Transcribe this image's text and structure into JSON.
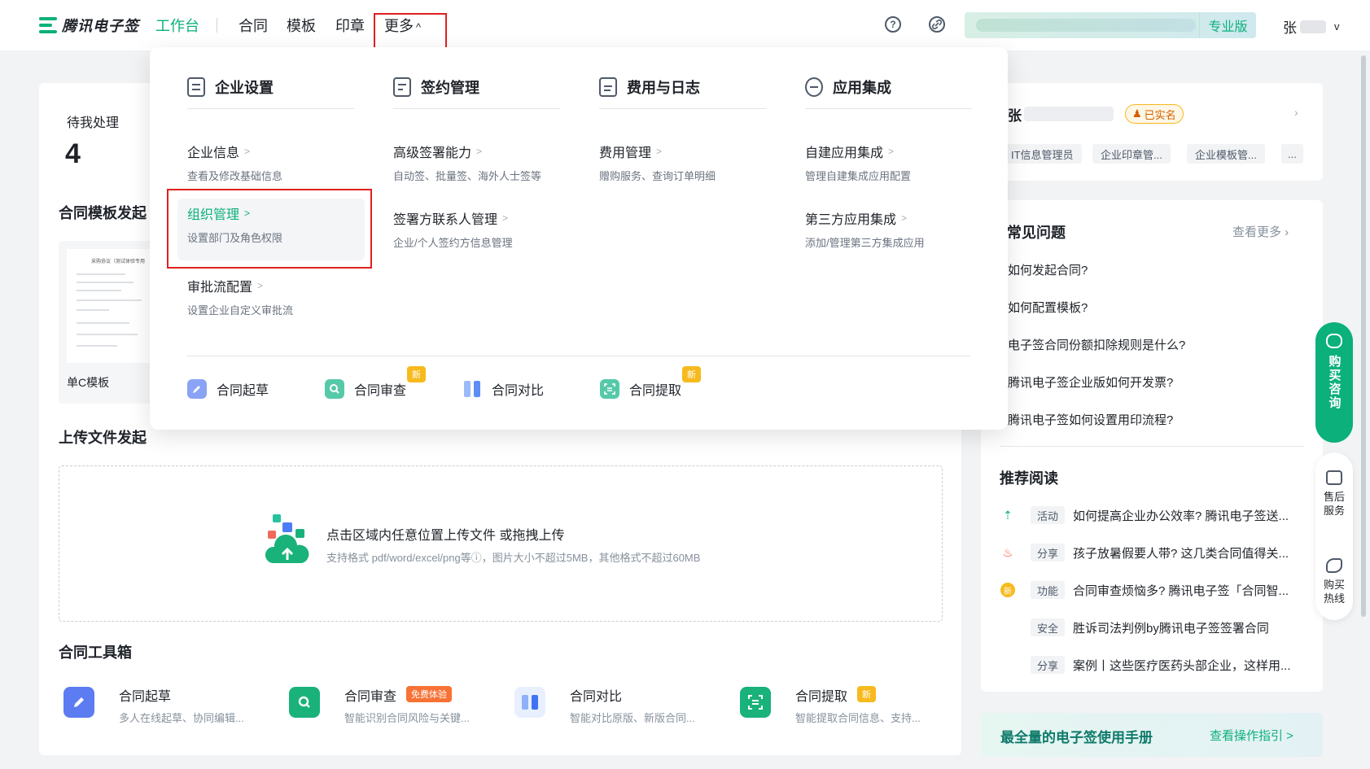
{
  "nav": {
    "logo": "腾讯电子签",
    "items": [
      "工作台",
      "合同",
      "模板",
      "印章",
      "更多"
    ],
    "more_arrow": "^",
    "help_icon": "?",
    "edition": "专业版",
    "user_initial": "张",
    "user_chevron": "v"
  },
  "main": {
    "pending_label": "待我处理",
    "pending_count": "4",
    "template_section": "合同模板发起",
    "template_card_label": "单C模板",
    "template_doc_title": "采购协议（测试体验专用",
    "upload_section": "上传文件发起",
    "upload_main": "点击区域内任意位置上传文件 或拖拽上传",
    "upload_sub": "支持格式 pdf/word/excel/png等ⓘ，图片大小不超过5MB，其他格式不超过60MB",
    "toolbox_section": "合同工具箱",
    "tools": [
      {
        "name": "合同起草",
        "desc": "多人在线起草、协同编辑...",
        "badge": ""
      },
      {
        "name": "合同审查",
        "desc": "智能识别合同风险与关键...",
        "badge": "免费体验"
      },
      {
        "name": "合同对比",
        "desc": "智能对比原版、新版合同...",
        "badge": ""
      },
      {
        "name": "合同提取",
        "desc": "智能提取合同信息、支持...",
        "badge": "新"
      }
    ]
  },
  "right": {
    "user_initial": "张",
    "verified": "已实名",
    "role_tags": [
      "IT信息管理员",
      "企业印章管...",
      "企业模板管...",
      "..."
    ],
    "faq_title": "常见问题",
    "faq_more": "查看更多",
    "faq_items": [
      "如何发起合同?",
      "如何配置模板?",
      "电子签合同份额扣除规则是什么?",
      "腾讯电子签企业版如何开发票?",
      "腾讯电子签如何设置用印流程?"
    ],
    "read_title": "推荐阅读",
    "reads": [
      {
        "icon": "⇡",
        "tag": "活动",
        "text": "如何提高企业办公效率? 腾讯电子签送..."
      },
      {
        "icon": "♨",
        "tag": "分享",
        "text": "孩子放暑假要人带? 这几类合同值得关..."
      },
      {
        "icon": "新",
        "tag": "功能",
        "text": "合同审查烦恼多? 腾讯电子签「合同智..."
      },
      {
        "icon": "",
        "tag": "安全",
        "text": "胜诉司法判例by腾讯电子签签署合同"
      },
      {
        "icon": "",
        "tag": "分享",
        "text": "案例丨这些医疗医药头部企业，这样用..."
      }
    ],
    "manual_title": "最全量的电子签使用手册",
    "manual_link": "查看操作指引 >"
  },
  "float": {
    "buy": "购买咨询",
    "after_sale": "售后服务",
    "hotline": "购买热线"
  },
  "dropdown": {
    "columns": [
      {
        "title": "企业设置",
        "entries": [
          {
            "title": "企业信息",
            "desc": "查看及修改基础信息"
          },
          {
            "title": "组织管理",
            "desc": "设置部门及角色权限"
          },
          {
            "title": "审批流配置",
            "desc": "设置企业自定义审批流"
          }
        ]
      },
      {
        "title": "签约管理",
        "entries": [
          {
            "title": "高级签署能力",
            "desc": "自动签、批量签、海外人士签等"
          },
          {
            "title": "签署方联系人管理",
            "desc": "企业/个人签约方信息管理"
          }
        ]
      },
      {
        "title": "费用与日志",
        "entries": [
          {
            "title": "费用管理",
            "desc": "赠购服务、查询订单明细"
          }
        ]
      },
      {
        "title": "应用集成",
        "entries": [
          {
            "title": "自建应用集成",
            "desc": "管理自建集成应用配置"
          },
          {
            "title": "第三方应用集成",
            "desc": "添加/管理第三方集成应用"
          }
        ]
      }
    ],
    "quick": [
      {
        "label": "合同起草",
        "badge": ""
      },
      {
        "label": "合同审查",
        "badge": "新"
      },
      {
        "label": "合同对比",
        "badge": ""
      },
      {
        "label": "合同提取",
        "badge": "新"
      }
    ],
    "arrow": ">"
  },
  "colors": {
    "accent": "#0bb07b",
    "highlight_border": "#e02020",
    "badge_orange": "#f77234",
    "badge_yellow": "#f7ba1e"
  }
}
